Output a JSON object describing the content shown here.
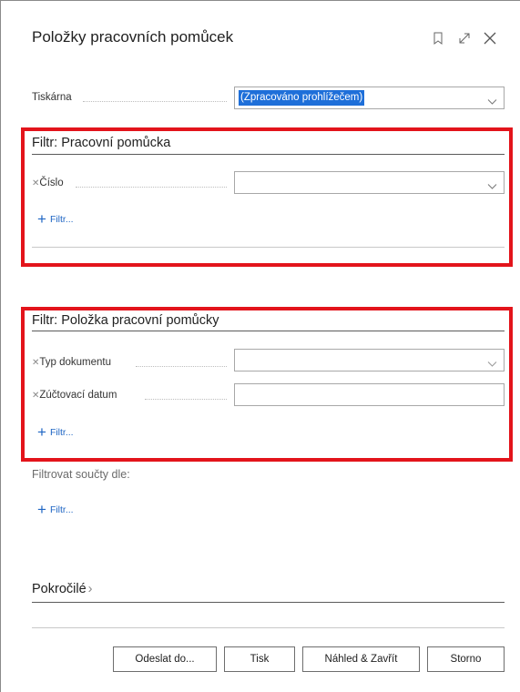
{
  "dialog": {
    "title": "Položky pracovních pomůcek",
    "icons": [
      "bookmark-icon",
      "expand-icon",
      "close-icon"
    ]
  },
  "printer": {
    "label": "Tiskárna",
    "value": "(Zpracováno prohlížečem)"
  },
  "filter_tool": {
    "title": "Filtr: Pracovní pomůcka",
    "fields": [
      {
        "label": "Číslo",
        "value": ""
      }
    ],
    "add_filter": "Filtr..."
  },
  "filter_entry": {
    "title": "Filtr: Položka pracovní pomůcky",
    "fields": [
      {
        "label": "Typ dokumentu",
        "value": ""
      },
      {
        "label": "Zúčtovací datum",
        "value": ""
      }
    ],
    "add_filter": "Filtr..."
  },
  "totals": {
    "label": "Filtrovat součty dle:",
    "add_filter": "Filtr..."
  },
  "advanced": {
    "label": "Pokročilé",
    "chevron": "›"
  },
  "buttons": {
    "send": "Odeslat do...",
    "print": "Tisk",
    "preview": "Náhled & Zavřít",
    "cancel": "Storno"
  },
  "colors": {
    "highlight_box": "#e3141b",
    "selection": "#1e6fd9",
    "link": "#1f66c4"
  }
}
